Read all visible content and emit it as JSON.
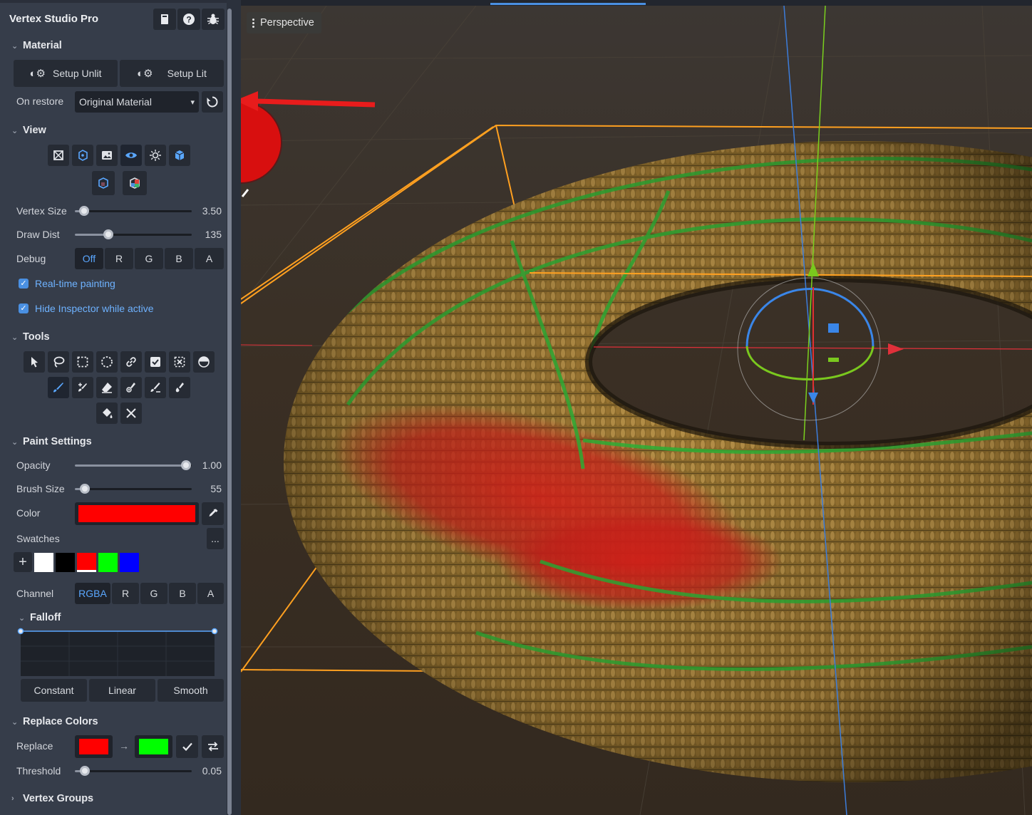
{
  "app": {
    "title": "Vertex Studio Pro"
  },
  "header_icons": [
    "book-icon",
    "help-icon",
    "bug-icon"
  ],
  "material": {
    "section": "Material",
    "setup_unlit": "Setup Unlit",
    "setup_lit": "Setup Lit",
    "on_restore_label": "On restore",
    "on_restore_value": "Original Material"
  },
  "view": {
    "section": "View",
    "vertex_size": {
      "label": "Vertex Size",
      "value": "3.50",
      "fraction": 0.08
    },
    "draw_dist": {
      "label": "Draw Dist",
      "value": "135",
      "fraction": 0.28
    },
    "debug": {
      "label": "Debug",
      "options": [
        "Off",
        "R",
        "G",
        "B",
        "A"
      ],
      "selected": "Off"
    },
    "realtime": {
      "label": "Real-time painting",
      "checked": true
    },
    "hide_inspector": {
      "label": "Hide Inspector while active",
      "checked": true
    }
  },
  "tools": {
    "section": "Tools"
  },
  "paint": {
    "section": "Paint Settings",
    "opacity": {
      "label": "Opacity",
      "value": "1.00",
      "fraction": 1.0
    },
    "brush_size": {
      "label": "Brush Size",
      "value": "55",
      "fraction": 0.09
    },
    "color": {
      "label": "Color",
      "value": "#ff0000"
    },
    "swatches": {
      "label": "Swatches",
      "more": "...",
      "add": "+",
      "colors": [
        "#ffffff",
        "#000000",
        "#ff0000",
        "#00ff00",
        "#0000ff"
      ]
    },
    "channel": {
      "label": "Channel",
      "options": [
        "RGBA",
        "R",
        "G",
        "B",
        "A"
      ],
      "selected": "RGBA"
    }
  },
  "falloff": {
    "section": "Falloff",
    "buttons": [
      "Constant",
      "Linear",
      "Smooth"
    ]
  },
  "replace": {
    "section": "Replace Colors",
    "label": "Replace",
    "from": "#ff0000",
    "to": "#00ff00",
    "arrow": "→",
    "threshold": {
      "label": "Threshold",
      "value": "0.05",
      "fraction": 0.09
    }
  },
  "vertex_groups": {
    "section": "Vertex Groups"
  },
  "viewport": {
    "mode": "Perspective"
  },
  "colors": {
    "accent": "#5aa7ff",
    "panel": "#363d4a",
    "selection": "#ffa020"
  }
}
